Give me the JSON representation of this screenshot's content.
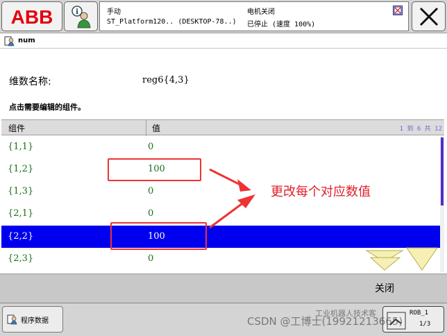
{
  "topbar": {
    "logo_text": "ABB",
    "status": {
      "mode": "手动",
      "system": "ST_Platform120.. (DESKTOP-78..)",
      "motor": "电机关闭",
      "state": "已停止 (速度 100%)"
    }
  },
  "window": {
    "title": "num"
  },
  "info": {
    "dimension_label": "维数名称:",
    "dimension_value": "reg6{4,3}",
    "hint": "点击需要编辑的组件。"
  },
  "table": {
    "col_component": "组件",
    "col_value": "值",
    "page_info": "1 到 6 共 12",
    "rows": [
      {
        "component": "{1,1}",
        "value": "0"
      },
      {
        "component": "{1,2}",
        "value": "100"
      },
      {
        "component": "{1,3}",
        "value": "0"
      },
      {
        "component": "{2,1}",
        "value": "0"
      },
      {
        "component": "{2,2}",
        "value": "100"
      },
      {
        "component": "{2,3}",
        "value": "0"
      }
    ],
    "selected_index": 4
  },
  "annotation": "更改每个对应数值",
  "actions": {
    "close_label": "关闭"
  },
  "taskbar": {
    "program_data_label": "程序数据",
    "rob_label": "ROB_1",
    "rob_fraction": "1/3"
  },
  "watermark": {
    "main": "CSDN @工博士(19921213665)",
    "secondary": "工业机器人技术客"
  },
  "colors": {
    "selected_row": "#0000ee",
    "value_text": "#1a6e1a",
    "annotation": "#e0202a",
    "page_info": "#6b6bd6"
  }
}
